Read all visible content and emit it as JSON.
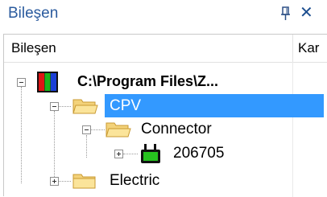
{
  "panel": {
    "title": "Bileşen",
    "pin_icon": "pin-icon",
    "close_label": "✕"
  },
  "columns": {
    "name": "Bileşen",
    "second": "Kar"
  },
  "tree": {
    "root_label": "C:\\Program Files\\Z...",
    "cpv_label": "CPV",
    "connector_label": "Connector",
    "item_label": "206705",
    "electric_label": "Electric"
  },
  "colors": {
    "selection": "#3399ff",
    "title": "#2b5b9e",
    "folder": "#f1c75b"
  }
}
